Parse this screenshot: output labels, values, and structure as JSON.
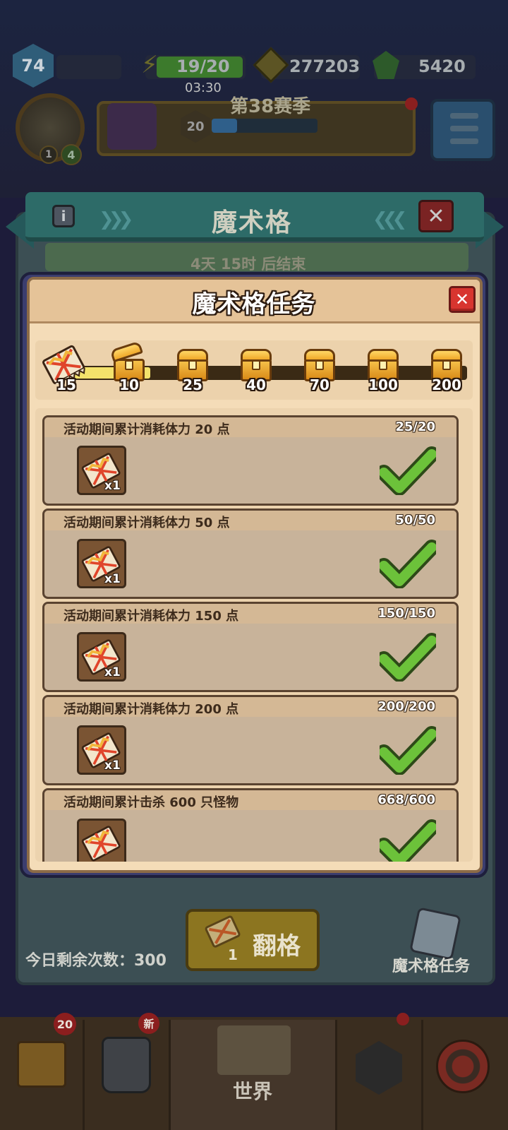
{
  "hud": {
    "level": "74",
    "energy": "19/20",
    "energy_timer": "03:30",
    "gold": "277203",
    "gems": "5420",
    "season_title": "第38赛季",
    "season_level": "20",
    "avatar_badge_a": "1",
    "avatar_badge_b": "4"
  },
  "magic_grid": {
    "title": "魔术格",
    "countdown": "4天 15时 后结束",
    "remaining_today": "今日剩余次数：300",
    "flip_label": "翻格",
    "flip_cost": "1",
    "quest_button": "魔术格任务"
  },
  "bottom_nav": {
    "chest_badge": "20",
    "armor_badge": "新",
    "world_label": "世界"
  },
  "quest_modal": {
    "title": "魔术格任务",
    "close_icon": "✕",
    "current_tickets": 15,
    "current_tickets_label": "15",
    "milestones": [
      {
        "label": "10",
        "state": "opened"
      },
      {
        "label": "25",
        "state": "locked"
      },
      {
        "label": "40",
        "state": "locked"
      },
      {
        "label": "70",
        "state": "locked"
      },
      {
        "label": "100",
        "state": "locked"
      },
      {
        "label": "200",
        "state": "locked"
      }
    ],
    "tasks": [
      {
        "desc": "活动期间累计消耗体力 20 点",
        "progress": "25/20",
        "reward_qty": "x1",
        "done": true
      },
      {
        "desc": "活动期间累计消耗体力 50 点",
        "progress": "50/50",
        "reward_qty": "x1",
        "done": true
      },
      {
        "desc": "活动期间累计消耗体力 150 点",
        "progress": "150/150",
        "reward_qty": "x1",
        "done": true
      },
      {
        "desc": "活动期间累计消耗体力 200 点",
        "progress": "200/200",
        "reward_qty": "x1",
        "done": true
      },
      {
        "desc": "活动期间累计击杀 600 只怪物",
        "progress": "668/600",
        "reward_qty": "",
        "done": true
      }
    ]
  },
  "colors": {
    "modal_bg": "#f4dcb8",
    "check_green": "#6cc23a",
    "close_red": "#d8352f",
    "progress_fill": "#f3e26b"
  }
}
